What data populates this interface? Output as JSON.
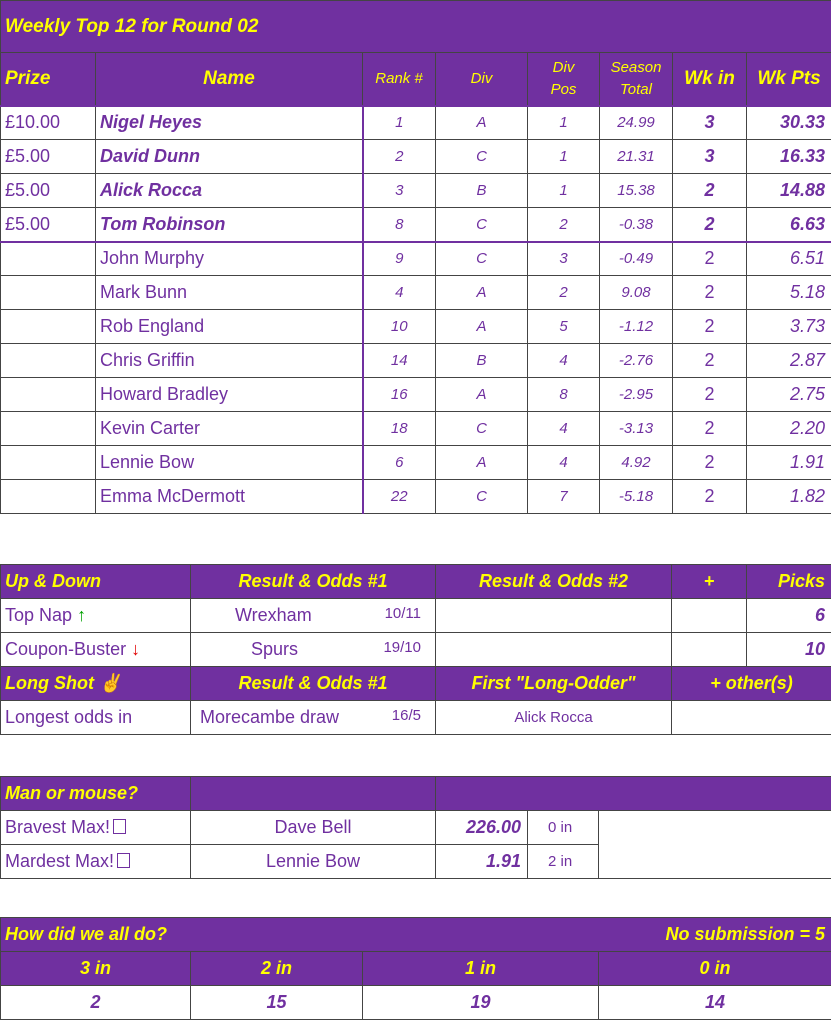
{
  "weekly": {
    "title": "Weekly Top 12 for Round 02",
    "headers": {
      "prize": "Prize",
      "name": "Name",
      "rank": "Rank #",
      "div": "Div",
      "divpos_1": "Div",
      "divpos_2": "Pos",
      "season_1": "Season",
      "season_2": "Total",
      "wkin": "Wk in",
      "wkpts": "Wk Pts"
    },
    "rows": [
      {
        "prize": "£10.00",
        "name": "Nigel Heyes",
        "rank": "1",
        "div": "A",
        "pos": "1",
        "season": "24.99",
        "wkin": "3",
        "wkpts": "30.33"
      },
      {
        "prize": "£5.00",
        "name": "David Dunn",
        "rank": "2",
        "div": "C",
        "pos": "1",
        "season": "21.31",
        "wkin": "3",
        "wkpts": "16.33"
      },
      {
        "prize": "£5.00",
        "name": "Alick Rocca",
        "rank": "3",
        "div": "B",
        "pos": "1",
        "season": "15.38",
        "wkin": "2",
        "wkpts": "14.88"
      },
      {
        "prize": "£5.00",
        "name": "Tom Robinson",
        "rank": "8",
        "div": "C",
        "pos": "2",
        "season": "-0.38",
        "wkin": "2",
        "wkpts": "6.63"
      },
      {
        "prize": "",
        "name": "John Murphy",
        "rank": "9",
        "div": "C",
        "pos": "3",
        "season": "-0.49",
        "wkin": "2",
        "wkpts": "6.51"
      },
      {
        "prize": "",
        "name": "Mark Bunn",
        "rank": "4",
        "div": "A",
        "pos": "2",
        "season": "9.08",
        "wkin": "2",
        "wkpts": "5.18"
      },
      {
        "prize": "",
        "name": "Rob England",
        "rank": "10",
        "div": "A",
        "pos": "5",
        "season": "-1.12",
        "wkin": "2",
        "wkpts": "3.73"
      },
      {
        "prize": "",
        "name": "Chris Griffin",
        "rank": "14",
        "div": "B",
        "pos": "4",
        "season": "-2.76",
        "wkin": "2",
        "wkpts": "2.87"
      },
      {
        "prize": "",
        "name": "Howard Bradley",
        "rank": "16",
        "div": "A",
        "pos": "8",
        "season": "-2.95",
        "wkin": "2",
        "wkpts": "2.75"
      },
      {
        "prize": "",
        "name": "Kevin Carter",
        "rank": "18",
        "div": "C",
        "pos": "4",
        "season": "-3.13",
        "wkin": "2",
        "wkpts": "2.20"
      },
      {
        "prize": "",
        "name": "Lennie Bow",
        "rank": "6",
        "div": "A",
        "pos": "4",
        "season": "4.92",
        "wkin": "2",
        "wkpts": "1.91"
      },
      {
        "prize": "",
        "name": "Emma McDermott",
        "rank": "22",
        "div": "C",
        "pos": "7",
        "season": "-5.18",
        "wkin": "2",
        "wkpts": "1.82"
      }
    ]
  },
  "updown": {
    "header": {
      "label": "Up & Down",
      "result1": "Result & Odds #1",
      "result2": "Result & Odds #2",
      "plus": "+",
      "picks": "Picks"
    },
    "topnap": {
      "label": "Top Nap",
      "arrow": "↑",
      "team": "Wrexham",
      "odds": "10/11",
      "picks": "6"
    },
    "coupon": {
      "label": "Coupon-Buster",
      "arrow": "↓",
      "team": "Spurs",
      "odds": "19/10",
      "picks": "10"
    },
    "longshot_header": {
      "label": "Long Shot",
      "icon": "✌",
      "result1": "Result & Odds #1",
      "first": "First \"Long-Odder\"",
      "others": "+ other(s)"
    },
    "longest": {
      "label": "Longest odds in",
      "team": "Morecambe draw",
      "odds": "16/5",
      "first": "Alick Rocca"
    }
  },
  "mouse": {
    "header": "Man or mouse?",
    "bravest": {
      "label": "Bravest Max!",
      "name": "Dave Bell",
      "score": "226.00",
      "in": "0 in"
    },
    "mardest": {
      "label": "Mardest Max!",
      "name": "Lennie Bow",
      "score": "1.91",
      "in": "2 in"
    }
  },
  "howdid": {
    "title": "How did we all do?",
    "nosub": "No submission = 5",
    "headers": [
      "3 in",
      "2 in",
      "1 in",
      "0 in"
    ],
    "values": [
      "2",
      "15",
      "19",
      "14"
    ]
  },
  "colors": {
    "purple": "#7030a0",
    "yellow": "#ffff00",
    "green": "#00a000",
    "red": "#e00000"
  }
}
